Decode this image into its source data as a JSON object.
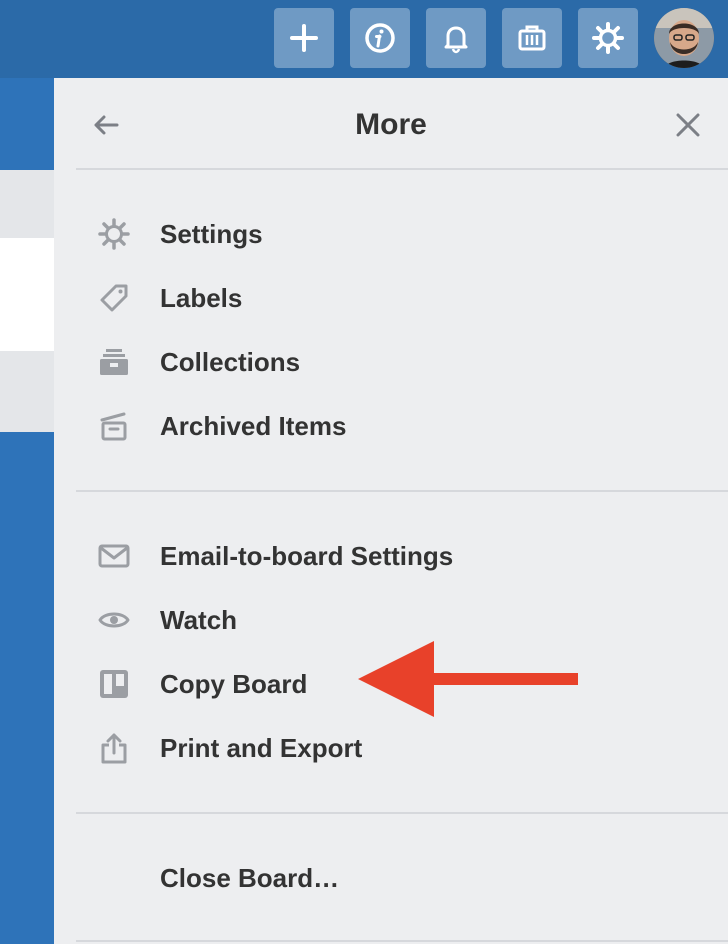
{
  "header": {
    "buttons": [
      {
        "name": "add",
        "icon": "plus-icon"
      },
      {
        "name": "info",
        "icon": "info-icon"
      },
      {
        "name": "notifications",
        "icon": "bell-icon"
      },
      {
        "name": "boards",
        "icon": "briefcase-icon"
      },
      {
        "name": "settings",
        "icon": "gear-icon"
      }
    ],
    "avatar": "avatar"
  },
  "panel": {
    "title": "More",
    "sections": [
      {
        "items": [
          {
            "label": "Settings",
            "icon": "gear-icon"
          },
          {
            "label": "Labels",
            "icon": "tag-icon"
          },
          {
            "label": "Collections",
            "icon": "collections-icon"
          },
          {
            "label": "Archived Items",
            "icon": "archive-icon"
          }
        ]
      },
      {
        "items": [
          {
            "label": "Email-to-board Settings",
            "icon": "envelope-icon"
          },
          {
            "label": "Watch",
            "icon": "eye-icon"
          },
          {
            "label": "Copy Board",
            "icon": "board-icon"
          },
          {
            "label": "Print and Export",
            "icon": "share-icon"
          }
        ]
      },
      {
        "items": [
          {
            "label": "Close Board…",
            "icon": ""
          }
        ]
      }
    ]
  },
  "annotation": {
    "color": "#e8412a",
    "points_to": "Copy Board"
  }
}
